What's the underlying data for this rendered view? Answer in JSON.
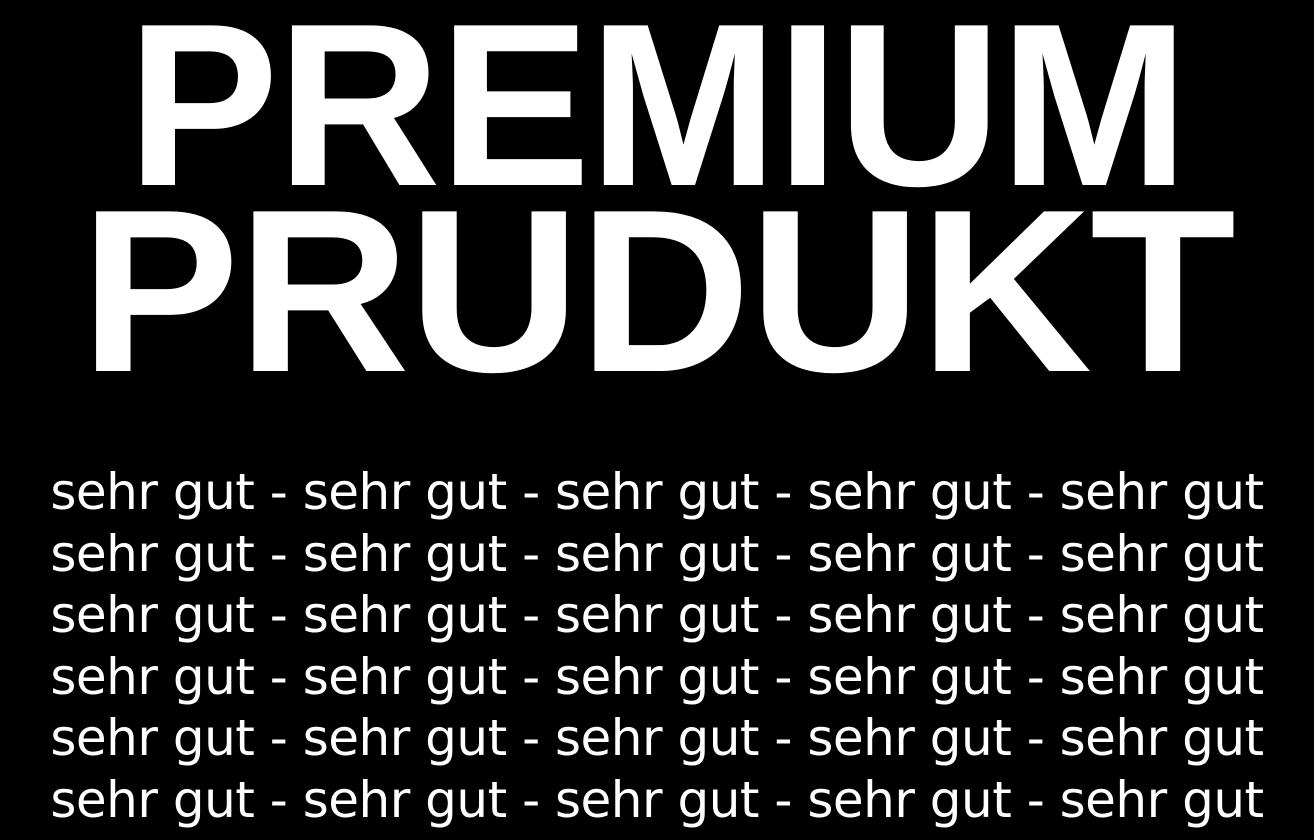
{
  "headline": {
    "line1": "PREMIUM",
    "line2": "PRUDUKT"
  },
  "tagline_lines": [
    "sehr gut - sehr gut - sehr gut - sehr gut - sehr gut",
    "sehr gut - sehr gut - sehr gut - sehr gut - sehr gut",
    "sehr gut - sehr gut - sehr gut - sehr gut - sehr gut",
    "sehr gut - sehr gut - sehr gut - sehr gut - sehr gut",
    "sehr gut - sehr gut - sehr gut - sehr gut - sehr gut",
    "sehr gut - sehr gut - sehr gut - sehr gut - sehr gut"
  ],
  "colors": {
    "background": "#000000",
    "text": "#ffffff"
  }
}
